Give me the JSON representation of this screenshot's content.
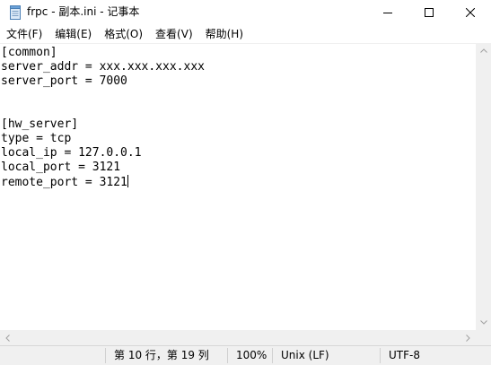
{
  "window": {
    "title": "frpc - 副本.ini - 记事本",
    "app_icon": "notepad-icon",
    "minimize_icon": "minimize-icon",
    "maximize_icon": "maximize-icon",
    "close_icon": "close-icon"
  },
  "menu": {
    "items": [
      {
        "label": "文件(F)"
      },
      {
        "label": "编辑(E)"
      },
      {
        "label": "格式(O)"
      },
      {
        "label": "查看(V)"
      },
      {
        "label": "帮助(H)"
      }
    ]
  },
  "editor": {
    "lines": [
      "[common]",
      "server_addr = xxx.xxx.xxx.xxx",
      "server_port = 7000",
      "",
      "",
      "[hw_server]",
      "type = tcp",
      "local_ip = 127.0.0.1",
      "local_port = 3121",
      "remote_port = 3121"
    ]
  },
  "scrollbars": {
    "up_icon": "arrow-up-icon",
    "down_icon": "arrow-down-icon",
    "left_icon": "arrow-left-icon",
    "right_icon": "arrow-right-icon"
  },
  "status": {
    "position": "第 10 行，第 19 列",
    "zoom": "100%",
    "line_ending": "Unix (LF)",
    "encoding": "UTF-8"
  },
  "colors": {
    "background": "#ffffff",
    "chrome": "#f0f0f0",
    "text": "#000000"
  }
}
